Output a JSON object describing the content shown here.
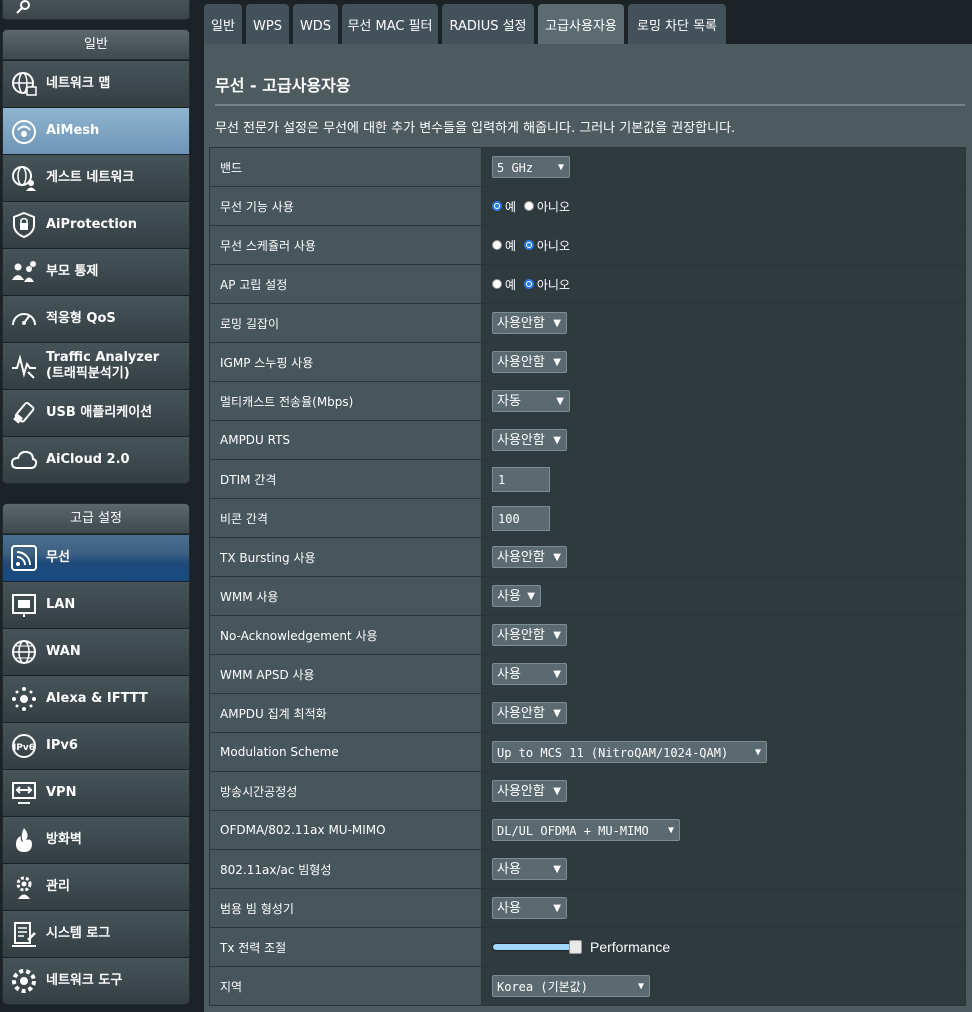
{
  "sidebar": {
    "general_header": "일반",
    "general_items": [
      {
        "label": "네트워크 맵",
        "icon": "network-map-icon"
      },
      {
        "label": "AiMesh",
        "icon": "aimesh-icon"
      },
      {
        "label": "게스트 네트워크",
        "icon": "guest-network-icon"
      },
      {
        "label": "AiProtection",
        "icon": "lock-icon"
      },
      {
        "label": "부모 통제",
        "icon": "family-icon"
      },
      {
        "label": "적응형 QoS",
        "icon": "speedometer-icon"
      },
      {
        "label": "Traffic Analyzer",
        "label2": "(트래픽분석기)",
        "icon": "traffic-analyzer-icon"
      },
      {
        "label": "USB 애플리케이션",
        "icon": "usb-icon"
      },
      {
        "label": "AiCloud 2.0",
        "icon": "cloud-icon"
      }
    ],
    "advanced_header": "고급 설정",
    "advanced_items": [
      {
        "label": "무선",
        "icon": "wireless-icon"
      },
      {
        "label": "LAN",
        "icon": "lan-icon"
      },
      {
        "label": "WAN",
        "icon": "globe-icon"
      },
      {
        "label": "Alexa & IFTTT",
        "icon": "alexa-icon"
      },
      {
        "label": "IPv6",
        "icon": "ipv6-icon"
      },
      {
        "label": "VPN",
        "icon": "vpn-icon"
      },
      {
        "label": "방화벽",
        "icon": "firewall-icon"
      },
      {
        "label": "관리",
        "icon": "admin-gear-icon"
      },
      {
        "label": "시스템 로그",
        "icon": "system-log-icon"
      },
      {
        "label": "네트워크 도구",
        "icon": "network-tools-icon"
      }
    ]
  },
  "tabs": [
    "일반",
    "WPS",
    "WDS",
    "무선 MAC 필터",
    "RADIUS 설정",
    "고급사용자용",
    "로밍 차단 목록"
  ],
  "active_tab": "고급사용자용",
  "page": {
    "title": "무선 - 고급사용자용",
    "description": "무선 전문가 설정은 무선에 대한 추가 변수들을 입력하게 해줍니다. 그러나 기본값을 권장합니다."
  },
  "radio_labels": {
    "yes": "예",
    "no": "아니오"
  },
  "settings": [
    {
      "label": "밴드",
      "value": "5 GHz"
    },
    {
      "label": "무선 기능 사용",
      "value": "예"
    },
    {
      "label": "무선 스케쥴러 사용",
      "value": "아니오"
    },
    {
      "label": "AP 고립 설정",
      "value": "아니오"
    },
    {
      "label": "로밍 길잡이",
      "value": "사용안함"
    },
    {
      "label": "IGMP 스누핑 사용",
      "value": "사용안함"
    },
    {
      "label": "멀티캐스트 전송율(Mbps)",
      "value": "자동"
    },
    {
      "label": "AMPDU RTS",
      "value": "사용안함"
    },
    {
      "label": "DTIM 간격",
      "value": "1"
    },
    {
      "label": "비콘 간격",
      "value": "100"
    },
    {
      "label": "TX Bursting 사용",
      "value": "사용안함"
    },
    {
      "label": "WMM 사용",
      "value": "사용"
    },
    {
      "label": "No-Acknowledgement 사용",
      "value": "사용안함"
    },
    {
      "label": "WMM APSD 사용",
      "value": "사용"
    },
    {
      "label": "AMPDU 집계 최적화",
      "value": "사용안함"
    },
    {
      "label": "Modulation Scheme",
      "value": "Up to MCS 11 (NitroQAM/1024-QAM)"
    },
    {
      "label": "방송시간공정성",
      "value": "사용안함"
    },
    {
      "label": "OFDMA/802.11ax MU-MIMO",
      "value": "DL/UL OFDMA + MU-MIMO"
    },
    {
      "label": "802.11ax/ac 빔형성",
      "value": "사용"
    },
    {
      "label": "범용 빔 형성기",
      "value": "사용"
    },
    {
      "label": "Tx 전력 조절",
      "value": "Performance",
      "level_percent": 100
    },
    {
      "label": "지역",
      "value": "Korea (기본값)"
    }
  ],
  "colors": {
    "active_item": "#184a80",
    "radio_selected": "#2b7de9",
    "slider_track": "#9fd7ff"
  }
}
